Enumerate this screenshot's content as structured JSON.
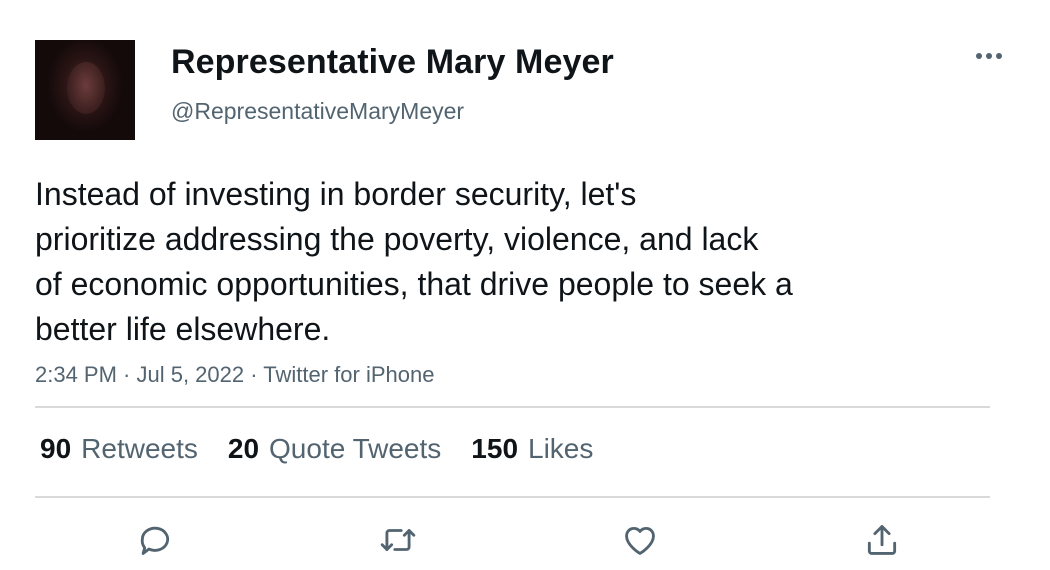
{
  "tweet": {
    "author": {
      "display_name": "Representative Mary Meyer",
      "handle": "@RepresentativeMaryMeyer"
    },
    "text_lines": [
      "Instead of investing in border security, let's",
      "prioritize addressing the poverty, violence, and lack",
      "of economic opportunities, that drive people to seek a",
      "better life elsewhere."
    ],
    "meta": "2:34 PM · Jul 5, 2022 · Twitter for iPhone",
    "stats": {
      "retweets": {
        "count": "90",
        "label": "Retweets"
      },
      "quotes": {
        "count": "20",
        "label": "Quote Tweets"
      },
      "likes": {
        "count": "150",
        "label": "Likes"
      }
    },
    "actions": {
      "icons": [
        "reply-icon",
        "retweet-icon",
        "like-icon",
        "share-icon"
      ]
    }
  },
  "colors": {
    "text_primary": "#0f1419",
    "text_secondary": "#536471",
    "divider": "#d7d9db",
    "icon": "#536471"
  }
}
